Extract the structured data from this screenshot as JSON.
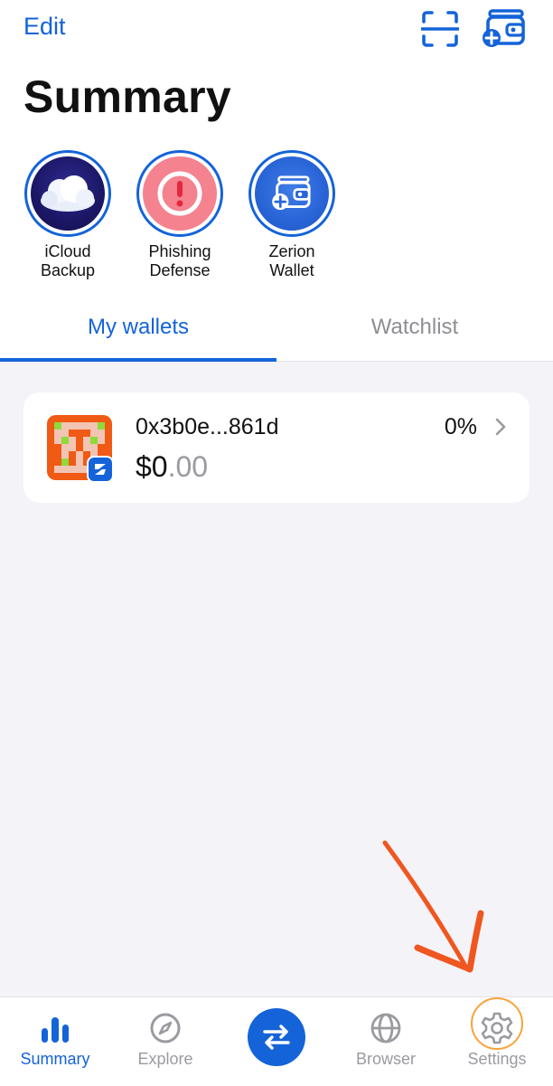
{
  "header": {
    "edit_label": "Edit",
    "title": "Summary"
  },
  "stories": [
    {
      "line1": "iCloud",
      "line2": "Backup"
    },
    {
      "line1": "Phishing",
      "line2": "Defense"
    },
    {
      "line1": "Zerion",
      "line2": "Wallet"
    }
  ],
  "tabs": {
    "my_wallets": "My wallets",
    "watchlist": "Watchlist"
  },
  "wallet": {
    "address": "0x3b0e...861d",
    "balance_main": "$0",
    "balance_decimals": ".00",
    "change": "0%"
  },
  "tabbar": {
    "summary": "Summary",
    "explore": "Explore",
    "browser": "Browser",
    "settings": "Settings"
  },
  "colors": {
    "accent": "#1463D9",
    "annotation": "#F0561F"
  }
}
